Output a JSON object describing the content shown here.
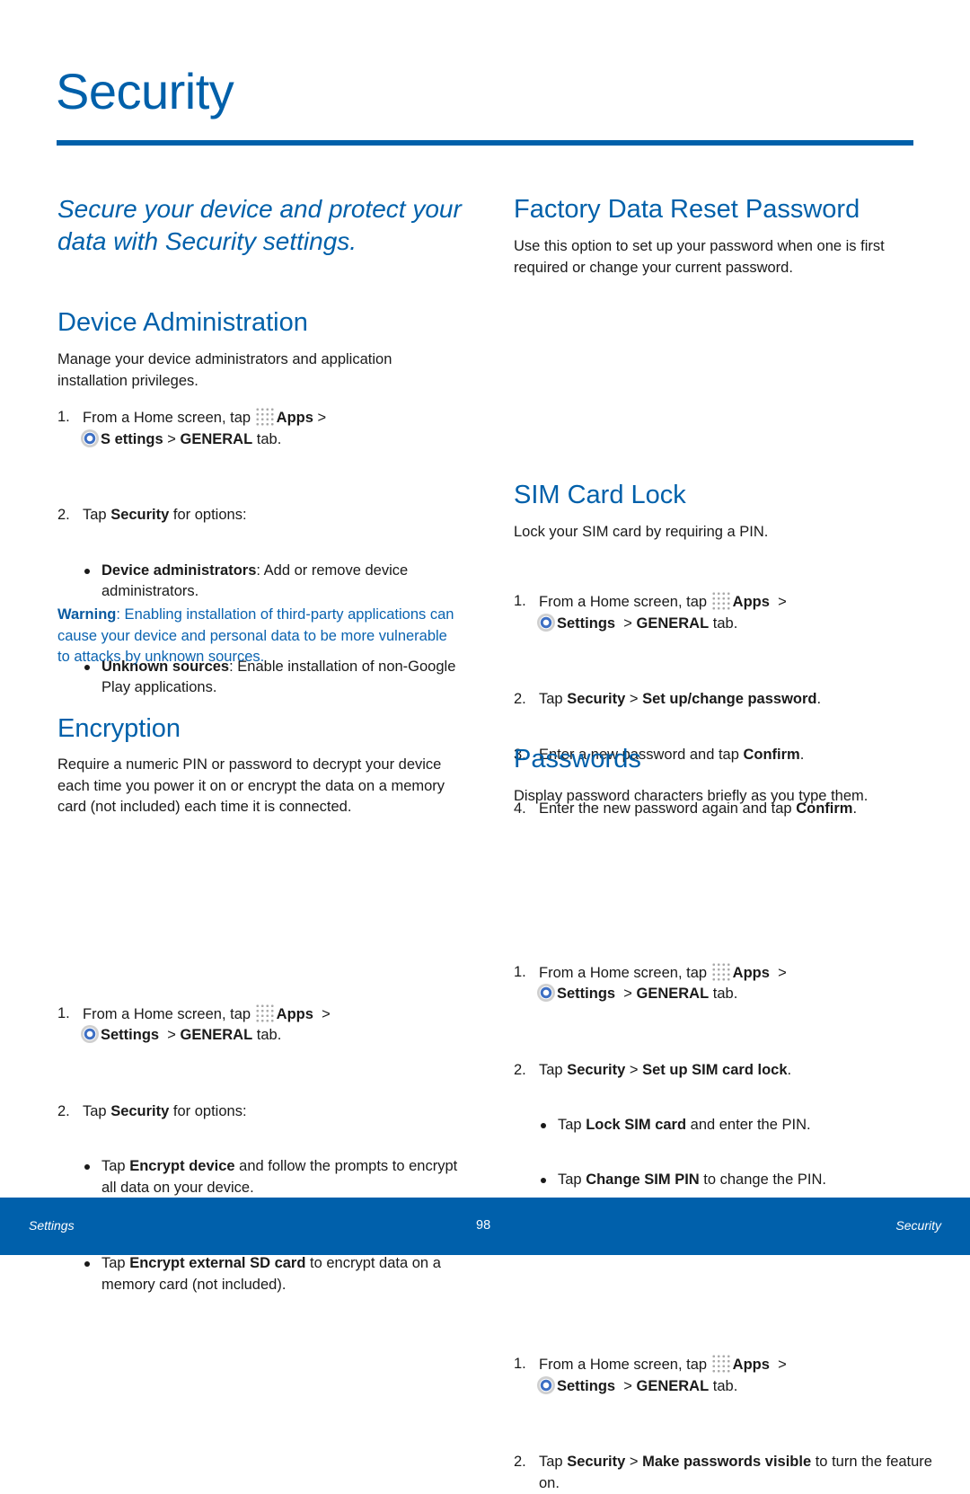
{
  "page": {
    "title": "Security",
    "subtitle": "Secure your device and protect your data with Security settings.",
    "accent_color": "#0060aa"
  },
  "common": {
    "step_home_prefix": "From a Home screen, tap ",
    "apps_label": "Apps",
    "gt": " > ",
    "settings_label": "Settings",
    "settings_label_split": "S ettings",
    "general_label": "GENERAL",
    "tab_suffix": " tab.",
    "tap": "Tap ",
    "security_label": "Security",
    "period": "."
  },
  "device_admin": {
    "heading": "Device Administration",
    "description": "Manage your device administrators and application installation privileges.",
    "step2_suffix": " for options:",
    "bullets": [
      {
        "bold": "Device administrators",
        "text": ": Add or remove device administrators."
      },
      {
        "bold": "Unknown sources",
        "text": ": Enable installation of non-Google Play applications."
      }
    ],
    "warning_label": "Warning",
    "warning_text": ": Enabling installation of third-party applications can cause your device and personal data to be more vulnerable to attacks by unknown sources."
  },
  "encryption": {
    "heading": "Encryption",
    "description": "Require a numeric PIN or password to decrypt your device each time you power it on or encrypt the data on a memory card (not included) each time it is connected.",
    "step2_suffix": " for options:",
    "bullets": [
      {
        "pre": "Tap ",
        "bold": "Encrypt device",
        "text": " and follow the prompts to encrypt all data on your device."
      },
      {
        "pre": "Tap ",
        "bold": "Encrypt external SD card",
        "text": " to encrypt data on a memory card (not included)."
      }
    ]
  },
  "factory_reset": {
    "heading": "Factory Data Reset Password",
    "description": "Use this option to set up your password when one is first required or change your current password.",
    "step2_bold": "Set up/change password",
    "step3_text": "Enter a new password and tap ",
    "step4_text": "Enter the new password again and tap ",
    "confirm_label": "Confirm"
  },
  "sim_lock": {
    "heading": "SIM Card Lock",
    "description": "Lock your SIM card by requiring a PIN.",
    "step2_bold": "Set up SIM card lock",
    "bullets": [
      {
        "pre": "Tap ",
        "bold": "Lock SIM card",
        "text": " and enter the PIN."
      },
      {
        "pre": "Tap ",
        "bold": "Change SIM PIN",
        "text": " to change the PIN."
      }
    ]
  },
  "passwords": {
    "heading": "Passwords",
    "description": "Display password characters briefly as you type them.",
    "step2_bold": "Make passwords visible",
    "step2_suffix": " to turn the feature on."
  },
  "footer": {
    "left": "Settings",
    "page_number": "98",
    "right": "Security"
  }
}
